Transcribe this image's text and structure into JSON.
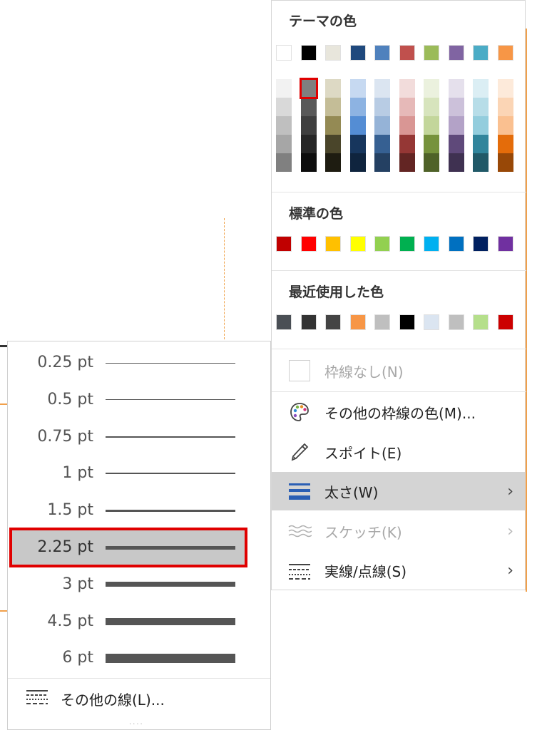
{
  "color_menu": {
    "theme_title": "テーマの色",
    "theme_base": [
      "#ffffff",
      "#000000",
      "#e8e6dc",
      "#1f497d",
      "#4f81bd",
      "#c0504d",
      "#9bbb59",
      "#8064a2",
      "#4bacc6",
      "#f79646"
    ],
    "theme_shades": [
      [
        "#f2f2f2",
        "#d9d9d9",
        "#bfbfbf",
        "#a6a6a6",
        "#808080"
      ],
      [
        "#7f7f7f",
        "#595959",
        "#3f3f3f",
        "#262626",
        "#0d0d0d"
      ],
      [
        "#ddd9c4",
        "#c4bd97",
        "#948a54",
        "#4a452a",
        "#1e1c11"
      ],
      [
        "#c6d9f1",
        "#8db3e2",
        "#548dd4",
        "#17365d",
        "#0f243e"
      ],
      [
        "#dbe5f1",
        "#b8cce4",
        "#95b3d7",
        "#366092",
        "#244062"
      ],
      [
        "#f2dcdb",
        "#e6b9b8",
        "#d99694",
        "#953735",
        "#632523"
      ],
      [
        "#ebf1de",
        "#d7e4bd",
        "#c3d69b",
        "#76923c",
        "#4f6228"
      ],
      [
        "#e5e0ec",
        "#ccc1da",
        "#b3a2c7",
        "#5f497a",
        "#3f3151"
      ],
      [
        "#dbeef4",
        "#b7dde8",
        "#93cddd",
        "#31859c",
        "#215968"
      ],
      [
        "#fdeada",
        "#fbd5b5",
        "#fac090",
        "#e46c0a",
        "#984807"
      ]
    ],
    "selected_shade": "1-0",
    "standard_title": "標準の色",
    "standard_colors": [
      "#c00000",
      "#ff0000",
      "#ffc000",
      "#ffff00",
      "#92d050",
      "#00b050",
      "#00b0f0",
      "#0070c0",
      "#002060",
      "#7030a0"
    ],
    "recent_title": "最近使用した色",
    "recent_colors": [
      "#4a4f55",
      "#333333",
      "#444444",
      "#f79646",
      "#bfbfbf",
      "#000000",
      "#dbe5f1",
      "#bfbfbf",
      "#b5df8b",
      "#cc0000"
    ],
    "no_border_label": "枠線なし(N)",
    "more_colors_label": "その他の枠線の色(M)...",
    "eyedropper_label": "スポイト(E)",
    "weight_label": "太さ(W)",
    "sketch_label": "スケッチ(K)",
    "dash_label": "実線/点線(S)",
    "chevron": "›"
  },
  "weight_menu": {
    "items": [
      {
        "label": "0.25 pt",
        "thickness": 0.25
      },
      {
        "label": "0.5 pt",
        "thickness": 0.5
      },
      {
        "label": "0.75 pt",
        "thickness": 0.75
      },
      {
        "label": "1 pt",
        "thickness": 1
      },
      {
        "label": "1.5 pt",
        "thickness": 1.5
      },
      {
        "label": "2.25 pt",
        "thickness": 2.25
      },
      {
        "label": "3 pt",
        "thickness": 3
      },
      {
        "label": "4.5 pt",
        "thickness": 4.5
      },
      {
        "label": "6 pt",
        "thickness": 6
      }
    ],
    "selected_label": "2.25 pt",
    "more_lines_label": "その他の線(L)...",
    "grip": "····"
  },
  "icons": {
    "palette": "palette-icon",
    "eyedropper": "eyedropper-icon",
    "weight": "line-weight-icon",
    "sketch": "sketch-icon",
    "dash": "dash-type-icon"
  }
}
